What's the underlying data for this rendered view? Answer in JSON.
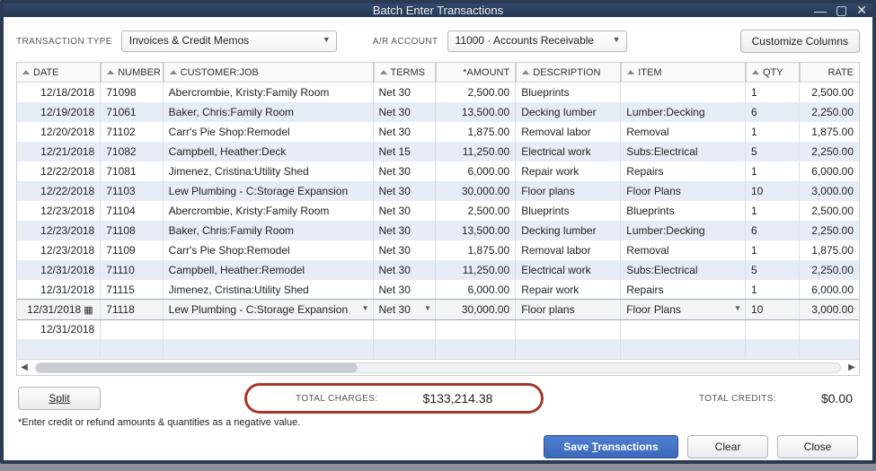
{
  "window": {
    "title": "Batch Enter Transactions"
  },
  "top": {
    "transactionTypeLabel": "TRANSACTION TYPE",
    "transactionType": "Invoices & Credit Memos",
    "arAccountLabel": "A/R ACCOUNT",
    "arAccount": "11000 · Accounts Receivable",
    "customize": "Customize Columns"
  },
  "columns": {
    "date": "DATE",
    "number": "NUMBER",
    "customer": "CUSTOMER:JOB",
    "terms": "TERMS",
    "amount": "*AMOUNT",
    "description": "DESCRIPTION",
    "item": "ITEM",
    "qty": "QTY",
    "rate": "RATE"
  },
  "rows": [
    {
      "date": "12/18/2018",
      "number": "71098",
      "customer": "Abercrombie, Kristy:Family Room",
      "terms": "Net 30",
      "amount": "2,500.00",
      "description": "Blueprints",
      "item": "",
      "qty": "1",
      "rate": "2,500.00"
    },
    {
      "date": "12/19/2018",
      "number": "71061",
      "customer": "Baker, Chris:Family Room",
      "terms": "Net 30",
      "amount": "13,500.00",
      "description": "Decking lumber",
      "item": "Lumber:Decking",
      "qty": "6",
      "rate": "2,250.00"
    },
    {
      "date": "12/20/2018",
      "number": "71102",
      "customer": "Carr's Pie Shop:Remodel",
      "terms": "Net 30",
      "amount": "1,875.00",
      "description": "Removal labor",
      "item": "Removal",
      "qty": "1",
      "rate": "1,875.00"
    },
    {
      "date": "12/21/2018",
      "number": "71082",
      "customer": "Campbell, Heather:Deck",
      "terms": "Net 15",
      "amount": "11,250.00",
      "description": "Electrical work",
      "item": "Subs:Electrical",
      "qty": "5",
      "rate": "2,250.00"
    },
    {
      "date": "12/22/2018",
      "number": "71081",
      "customer": "Jimenez, Cristina:Utility Shed",
      "terms": "Net 30",
      "amount": "6,000.00",
      "description": "Repair work",
      "item": "Repairs",
      "qty": "1",
      "rate": "6,000.00"
    },
    {
      "date": "12/22/2018",
      "number": "71103",
      "customer": "Lew Plumbing - C:Storage Expansion",
      "terms": "Net 30",
      "amount": "30,000.00",
      "description": "Floor plans",
      "item": "Floor Plans",
      "qty": "10",
      "rate": "3,000.00"
    },
    {
      "date": "12/23/2018",
      "number": "71104",
      "customer": "Abercrombie, Kristy:Family Room",
      "terms": "Net 30",
      "amount": "2,500.00",
      "description": "Blueprints",
      "item": "Blueprints",
      "qty": "1",
      "rate": "2,500.00"
    },
    {
      "date": "12/23/2018",
      "number": "71108",
      "customer": "Baker, Chris:Family Room",
      "terms": "Net 30",
      "amount": "13,500.00",
      "description": "Decking lumber",
      "item": "Lumber:Decking",
      "qty": "6",
      "rate": "2,250.00"
    },
    {
      "date": "12/23/2018",
      "number": "71109",
      "customer": "Carr's Pie Shop:Remodel",
      "terms": "Net 30",
      "amount": "1,875.00",
      "description": "Removal labor",
      "item": "Removal",
      "qty": "1",
      "rate": "1,875.00"
    },
    {
      "date": "12/31/2018",
      "number": "71110",
      "customer": "Campbell, Heather:Remodel",
      "terms": "Net 30",
      "amount": "11,250.00",
      "description": "Electrical work",
      "item": "Subs:Electrical",
      "qty": "5",
      "rate": "2,250.00"
    },
    {
      "date": "12/31/2018",
      "number": "71115",
      "customer": "Jimenez, Cristina:Utility Shed",
      "terms": "Net 30",
      "amount": "6,000.00",
      "description": "Repair work",
      "item": "Repairs",
      "qty": "1",
      "rate": "6,000.00"
    },
    {
      "date": "12/31/2018",
      "number": "71118",
      "customer": "Lew Plumbing - C:Storage Expansion",
      "terms": "Net 30",
      "amount": "30,000.00",
      "description": "Floor plans",
      "item": "Floor Plans",
      "qty": "10",
      "rate": "3,000.00",
      "active": true
    },
    {
      "date": "12/31/2018",
      "number": "",
      "customer": "",
      "terms": "",
      "amount": "",
      "description": "",
      "item": "",
      "qty": "",
      "rate": ""
    },
    {
      "date": "",
      "number": "",
      "customer": "",
      "terms": "",
      "amount": "",
      "description": "",
      "item": "",
      "qty": "",
      "rate": ""
    }
  ],
  "below": {
    "split": "Split",
    "totalChargesLabel": "TOTAL CHARGES:",
    "totalCharges": "$133,214.38",
    "totalCreditsLabel": "TOTAL CREDITS:",
    "totalCredits": "$0.00"
  },
  "hint": "*Enter credit or refund amounts & quantities as a negative value.",
  "actions": {
    "save": "Save Transactions",
    "clear": "Clear",
    "close": "Close"
  }
}
